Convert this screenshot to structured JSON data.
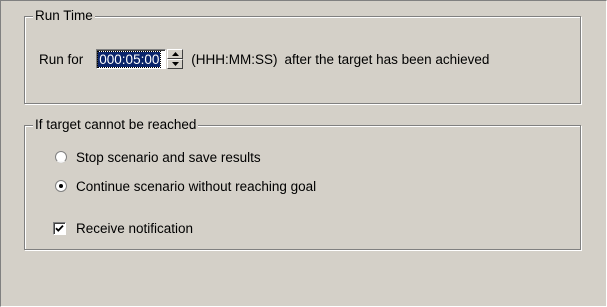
{
  "run_time": {
    "group_title": "Run Time",
    "run_for_label": "Run for",
    "duration_value": "000:05:00",
    "units_label": "(HHH:MM:SS)",
    "after_label": "after the target has been achieved"
  },
  "fallback": {
    "group_title": "If target cannot be reached",
    "options": [
      {
        "label": "Stop scenario and save results",
        "selected": false
      },
      {
        "label": "Continue scenario without reaching goal",
        "selected": true
      }
    ],
    "notify": {
      "label": "Receive notification",
      "checked": true
    }
  },
  "colors": {
    "dialog_background": "#d4d0c8",
    "selection_highlight": "#0a246a"
  }
}
